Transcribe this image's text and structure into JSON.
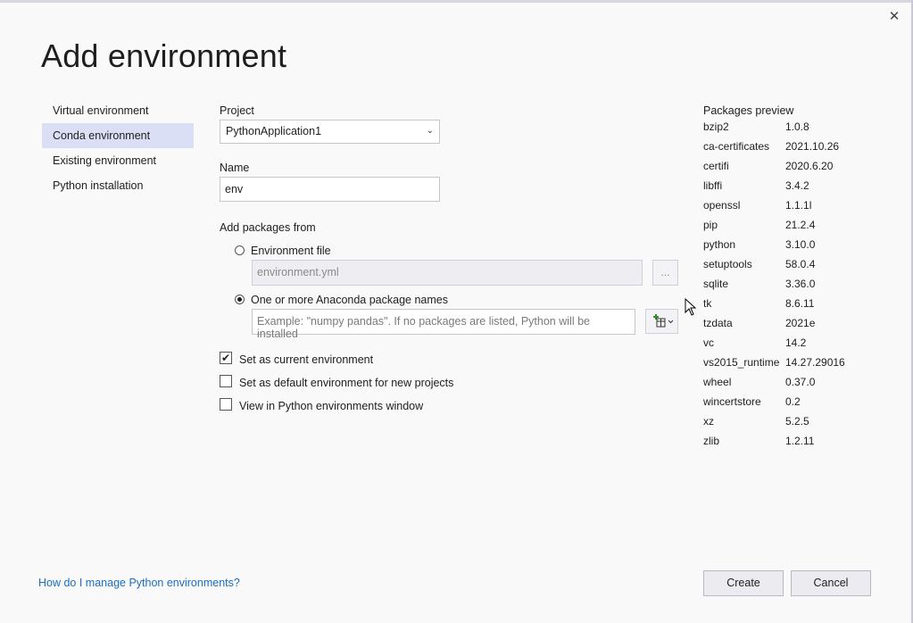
{
  "dialog": {
    "title": "Add environment",
    "close_icon": "close-icon"
  },
  "nav": {
    "items": [
      {
        "label": "Virtual environment",
        "selected": false
      },
      {
        "label": "Conda environment",
        "selected": true
      },
      {
        "label": "Existing environment",
        "selected": false
      },
      {
        "label": "Python installation",
        "selected": false
      }
    ]
  },
  "form": {
    "project_label": "Project",
    "project_value": "PythonApplication1",
    "name_label": "Name",
    "name_value": "env",
    "packages_from_label": "Add packages from",
    "env_file_label": "Environment file",
    "env_file_value": "environment.yml",
    "browse_label": "...",
    "anaconda_label": "One or more Anaconda package names",
    "anaconda_placeholder": "Example: \"numpy pandas\". If no packages are listed, Python will be installed",
    "selected_source": "anaconda",
    "checkboxes": [
      {
        "label": "Set as current environment",
        "checked": true
      },
      {
        "label": "Set as default environment for new projects",
        "checked": false
      },
      {
        "label": "View in Python environments window",
        "checked": false
      }
    ]
  },
  "packages_preview": {
    "title": "Packages preview",
    "packages": [
      {
        "name": "bzip2",
        "version": "1.0.8"
      },
      {
        "name": "ca-certificates",
        "version": "2021.10.26"
      },
      {
        "name": "certifi",
        "version": "2020.6.20"
      },
      {
        "name": "libffi",
        "version": "3.4.2"
      },
      {
        "name": "openssl",
        "version": "1.1.1l"
      },
      {
        "name": "pip",
        "version": "21.2.4"
      },
      {
        "name": "python",
        "version": "3.10.0"
      },
      {
        "name": "setuptools",
        "version": "58.0.4"
      },
      {
        "name": "sqlite",
        "version": "3.36.0"
      },
      {
        "name": "tk",
        "version": "8.6.11"
      },
      {
        "name": "tzdata",
        "version": "2021e"
      },
      {
        "name": "vc",
        "version": "14.2"
      },
      {
        "name": "vs2015_runtime",
        "version": "14.27.29016"
      },
      {
        "name": "wheel",
        "version": "0.37.0"
      },
      {
        "name": "wincertstore",
        "version": "0.2"
      },
      {
        "name": "xz",
        "version": "5.2.5"
      },
      {
        "name": "zlib",
        "version": "1.2.11"
      }
    ]
  },
  "footer": {
    "help_link": "How do I manage Python environments?",
    "create_label": "Create",
    "cancel_label": "Cancel"
  },
  "colors": {
    "accent_selection": "#dadff5",
    "link": "#1a6fbf",
    "add_icon_green": "#2e8b2e"
  }
}
